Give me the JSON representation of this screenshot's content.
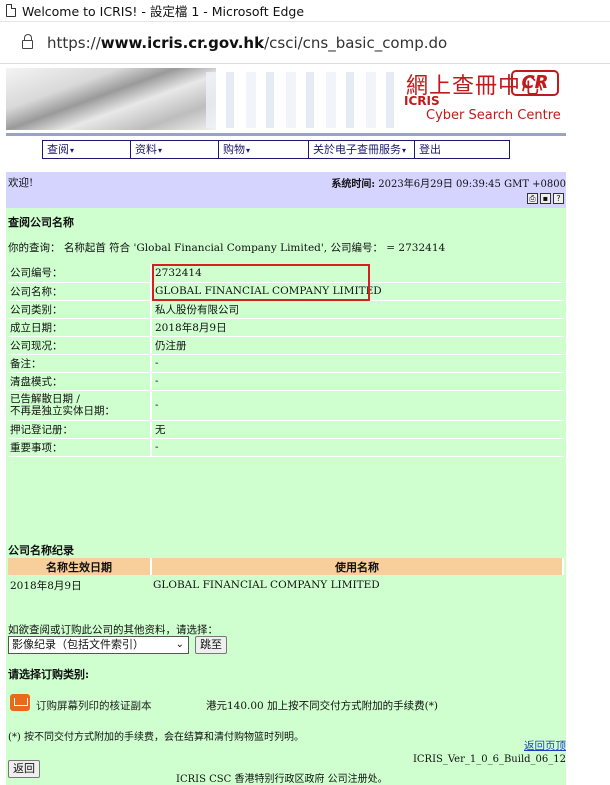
{
  "browser": {
    "title": "Welcome to ICRIS! - 設定檔 1 - Microsoft Edge",
    "url_prefix": "https://",
    "url_host": "www.icris.cr.gov.hk",
    "url_path": "/csci/cns_basic_comp.do"
  },
  "banner": {
    "cn_title": "網上查冊中心",
    "logo": "CR",
    "icris": "ICRIS",
    "subtitle": "Cyber Search Centre"
  },
  "menu": [
    {
      "label": "查阅",
      "caret": "▾"
    },
    {
      "label": "资料",
      "caret": "▾"
    },
    {
      "label": "购物",
      "caret": "▾"
    },
    {
      "label": "关於电子查冊服务",
      "caret": "▾"
    },
    {
      "label": "登出",
      "caret": ""
    }
  ],
  "header": {
    "welcome": "欢迎!",
    "systime_label": "系统时间:",
    "systime_value": "2023年6月29日 09:39:45 GMT +0800"
  },
  "section1": {
    "title": "查阅公司名称",
    "query": "你的查询： 名称起首 符合 'Global Financial Company Limited', 公司编号： = 2732414"
  },
  "company": {
    "rows": [
      {
        "label": "公司编号：",
        "value": "2732414"
      },
      {
        "label": "公司名称：",
        "value": "GLOBAL FINANCIAL COMPANY LIMITED"
      },
      {
        "label": "公司类别：",
        "value": "私人股份有限公司"
      },
      {
        "label": "成立日期：",
        "value": "2018年8月9日"
      },
      {
        "label": "公司现况：",
        "value": "仍注册"
      },
      {
        "label": "备注：",
        "value": "-"
      },
      {
        "label": "清盘模式：",
        "value": "-"
      },
      {
        "label_line1": "已告解散日期 /",
        "label_line2": "不再是独立实体日期：",
        "value": "-"
      },
      {
        "label": "押记登记册：",
        "value": "无"
      },
      {
        "label": "重要事项：",
        "value": "-"
      }
    ]
  },
  "history": {
    "title": "公司名称纪录",
    "col1": "名称生效日期",
    "col2": "使用名称",
    "rows": [
      {
        "date": "2018年8月9日",
        "name": "GLOBAL FINANCIAL COMPANY LIMITED"
      }
    ]
  },
  "more": {
    "prompt": "如欲查阅或订购此公司的其他资料，请选择：",
    "select_value": "影像纪录（包括文件索引）",
    "go_label": "跳至"
  },
  "order": {
    "title": "请选择订购类别:",
    "item": "订购屏幕列印的核证副本",
    "price": "港元140.00 加上按不同交付方式附加的手续费(*)",
    "note": "(*) 按不同交付方式附加的手续费，会在结算和清付购物篮时列明。",
    "back_label": "返回"
  },
  "footer": {
    "back_top": "返回页顶",
    "version": "ICRIS_Ver_1_0_6_Build_06_12",
    "copyright": "ICRIS CSC 香港特别行政区政府 公司注册处。"
  }
}
